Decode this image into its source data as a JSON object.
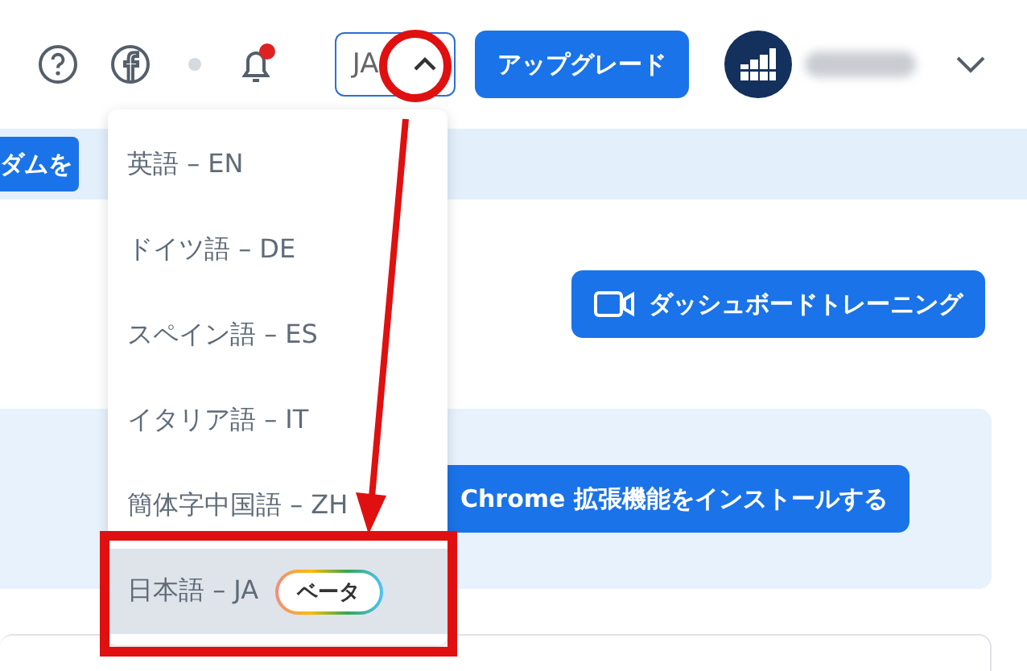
{
  "header": {
    "language_select": {
      "value": "JA",
      "expanded": true
    },
    "notifications": {
      "unread": true
    },
    "upgrade_button": "アップグレード"
  },
  "banner": {
    "button": "ダムを"
  },
  "training_button": "ダッシュボードトレーニング",
  "extension_button": "Chrome 拡張機能をインストールする",
  "language_menu": [
    {
      "label": "英語 – EN",
      "selected": false
    },
    {
      "label": "ドイツ語 – DE",
      "selected": false
    },
    {
      "label": "スペイン語 – ES",
      "selected": false
    },
    {
      "label": "イタリア語 – IT",
      "selected": false
    },
    {
      "label": "簡体字中国語 – ZH",
      "selected": false
    },
    {
      "label": "日本語 – JA",
      "selected": true,
      "badge": "ベータ"
    }
  ]
}
